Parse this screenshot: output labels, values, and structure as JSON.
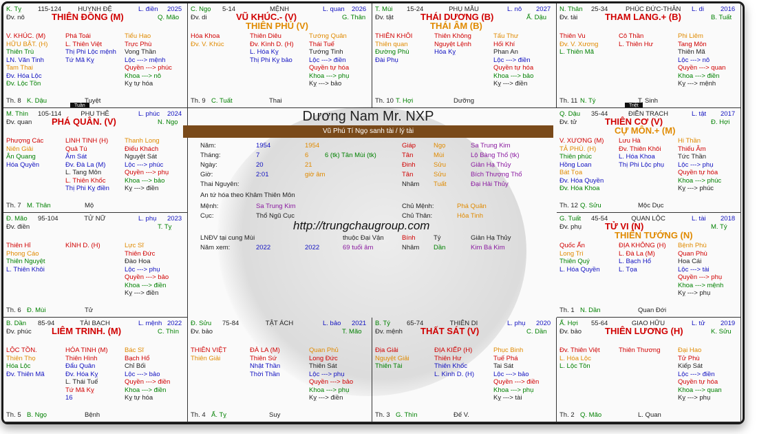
{
  "header": {
    "title": "Dương Nam  Mr. NXP",
    "band": "Vũ Phú Tí Ngọ sanh tài / lý tài",
    "url": "http://trungchaugroup.com"
  },
  "cells": {
    "ty": {
      "branch": "K. Tỵ",
      "range": "115-124",
      "palace": "HUYNH ĐỆ",
      "year_label": "L. điền",
      "year": "2025",
      "main": "THIÊN ĐỒNG  (M)",
      "dv": "Đv. nô",
      "dv2": "Q. Mão",
      "c1": [
        "V. KHÚC.  (M)",
        "HỮU BẬT.  (H)",
        "Thiên Trù",
        "LN. Văn Tinh",
        "Tam Thai",
        "Đv. Hóa Lộc",
        "Đv. Lộc Tồn"
      ],
      "c2": [
        "Phá Toái",
        "L. Thiên Việt",
        "Thị Phi Lộc mệnh",
        "Tứ Mã Kỵ"
      ],
      "c3": [
        "Tiểu Hao",
        "Trực Phù",
        "Vong Thần",
        "Lộc ---> mệnh",
        "Quyền ---> phúc",
        "Khoa ---> nô",
        "Kỵ tự hóa"
      ],
      "foot1": "Th. 8",
      "foot2": "K. Dậu",
      "foot3": "Tuyệt",
      "tag": "Tuần"
    },
    "ngo": {
      "branch": "C. Ngọ",
      "range": "5-14",
      "palace": "MỆNH",
      "year_label": "L. quan",
      "year": "2026",
      "main": "VŨ KHÚC.- (V)",
      "main2": "THIÊN PHỦ  (V)",
      "dv": "Đv. di",
      "dv2": "G. Thân",
      "c1": [
        "Hóa Khoa",
        "Đv. V. Khúc"
      ],
      "c2": [
        "Thiên Diêu",
        "Đv. Kình D.  (H)",
        "L. Hóa Kỵ",
        "Thị Phi Kỵ bảo"
      ],
      "c3": [
        "Tướng Quân",
        "Thái Tuế",
        "Tướng Tinh",
        "Lộc ---> điền",
        "Quyền tự hóa",
        "Khoa ---> phụ",
        "Kỵ ---> bảo"
      ],
      "foot1": "Th. 9",
      "foot2": "C. Tuất",
      "foot3": "Thai"
    },
    "mui": {
      "branch": "T. Mùi",
      "range": "15-24",
      "palace": "PHỤ MẪU",
      "year_label": "L. nô",
      "year": "2027",
      "main": "THÁI DƯƠNG  (B)",
      "main2": "THÁI ÂM  (B)",
      "dv": "Đv. tật",
      "dv2": "Ấ. Dậu",
      "c1": [
        "THIÊN KHÔI",
        "Thiên quan",
        "Đường Phù",
        "Đài Phụ"
      ],
      "c2": [
        "Thiên Không",
        "Nguyệt Lệnh",
        "Hóa Kỵ"
      ],
      "c3": [
        "Tấu Thư",
        "Hối Khí",
        "Phan An",
        "Lộc ---> điền",
        "Quyền tự hóa",
        "Khoa ---> bảo",
        "Kỵ ---> điền"
      ],
      "foot1": "Th. 10",
      "foot2": "T. Hợi",
      "foot3": "Dưỡng"
    },
    "than": {
      "branch": "N. Thân",
      "range": "25-34",
      "palace": "PHÚC ĐỨC-THÂN",
      "year_label": "L. di",
      "year": "2016",
      "main": "THAM LANG.+ (B)",
      "dv": "Đv. tài",
      "dv2": "B. Tuất",
      "c1": [
        "Thiên Vu",
        "Đv. V. Xương",
        "L. Thiên Mã"
      ],
      "c2": [
        "Cô Thần",
        "L. Thiên Hư"
      ],
      "c3": [
        "Phi Liêm",
        "Tang Môn",
        "Thiên Mã",
        "Lộc ---> nô",
        "Quyền ---> quan",
        "Khoa ---> điền",
        "Kỵ ---> mệnh"
      ],
      "foot1": "Th. 11",
      "foot2": "N. Tý",
      "foot3": "T. Sinh",
      "tag": "Triệt"
    },
    "thin": {
      "branch": "M. Thìn",
      "range": "105-114",
      "palace": "PHU THÊ",
      "year_label": "L. phúc",
      "year": "2024",
      "main": "PHÁ QUÂN.  (V)",
      "dv": "Đv. quan",
      "dv2": "N. Ngọ",
      "c1": [
        "Phượng Các",
        "Niên Giải",
        "Ân Quang",
        "Hóa Quyền"
      ],
      "c2": [
        "LINH TINH  (H)",
        "Quả Tú",
        "Âm Sát",
        "Đv. Đà La  (M)",
        "L. Tang Môn",
        "L. Thiên Khốc",
        "Thị Phi Kỵ điền"
      ],
      "c3": [
        "Thanh Long",
        "Điếu Khách",
        "Nguyệt Sát",
        "Lộc ---> phúc",
        "Quyền ---> phụ",
        "Khoa ---> bảo",
        "Kỵ ---> điền"
      ],
      "foot1": "Th. 7",
      "foot2": "M. Thân",
      "foot3": "Mộ"
    },
    "dau": {
      "branch": "Q. Dậu",
      "range": "35-44",
      "palace": "ĐIỀN TRẠCH",
      "year_label": "L. tật",
      "year": "2017",
      "main": "THIÊN CƠ  (V)",
      "main2": "CỰ MÔN.+ (M)",
      "dv": "Đv. tử",
      "dv2": "Đ. Hợi",
      "c1": [
        "V. XƯƠNG  (M)",
        "TẢ PHÙ.  (H)",
        "Thiên phúc",
        "Hồng Loan",
        "Bát Tọa",
        "Đv. Hóa Quyền",
        "Đv. Hóa Khoa"
      ],
      "c2": [
        "Lưu Hà",
        "Đv. Thiên Khôi",
        "L. Hóa Khoa",
        "Thị Phi Lộc phụ"
      ],
      "c3": [
        "Hi Thần",
        "Thiếu Âm",
        "Tức Thần",
        "Lộc ---> phụ",
        "Quyền tự hóa",
        "Khoa ---> phúc",
        "Kỵ ---> phúc"
      ],
      "foot1": "Th. 12",
      "foot2": "Q. Sửu",
      "foot3": "Mộc Dục"
    },
    "mao": {
      "branch": "Đ. Mão",
      "range": "95-104",
      "palace": "TỬ NỮ",
      "year_label": "L. phụ",
      "year": "2023",
      "main": "",
      "dv": "Đv. điền",
      "dv2": "T. Tỵ",
      "c1": [
        "Thiên Hỉ",
        "Phong Cáo",
        "Thiên Nguyệt",
        "L. Thiên Khôi"
      ],
      "c2": [
        "KÌNH D.  (H)"
      ],
      "c3": [
        "Lực Sĩ",
        "Thiên Đức",
        "Đào Hoa",
        "Lộc ---> phụ",
        "Quyền ---> bảo",
        "Khoa ---> điền",
        "Kỵ ---> điền"
      ],
      "foot1": "Th. 6",
      "foot2": "Đ. Mùi",
      "foot3": "Tử"
    },
    "tuat": {
      "branch": "G. Tuất",
      "range": "45-54",
      "palace": "QUAN LỘC",
      "year_label": "L. tài",
      "year": "2018",
      "main": "TỬ VI  (N)",
      "main2": "THIÊN TƯỚNG  (N)",
      "dv": "Đv. phụ",
      "dv2": "M. Tý",
      "c1": [
        "Quốc Ấn",
        "Long Trì",
        "Thiên Quý",
        "L. Hóa Quyền"
      ],
      "c2": [
        "ĐỊA KHÔNG  (H)",
        "L. Đà La  (M)",
        "L. Bạch Hổ",
        "L. Tọa"
      ],
      "c3": [
        "Bệnh Phù",
        "Quan Phù",
        "Hoa Cái",
        "Lộc ---> tài",
        "Quyền ---> phụ",
        "Khoa ---> mệnh",
        "Kỵ ---> phụ"
      ],
      "foot1": "Th. 1",
      "foot2": "N. Dần",
      "foot3": "Quan Đới"
    },
    "dan": {
      "branch": "B. Dần",
      "range": "85-94",
      "palace": "TÀI BẠCH",
      "year_label": "L. mệnh",
      "year": "2022",
      "main": "LIÊM TRINH.  (M)",
      "dv": "Đv. phúc",
      "dv2": "C. Thìn",
      "c1": [
        "LỘC TỒN.",
        "Thiên Thọ",
        "Hóa Lộc",
        "Đv. Thiên Mã"
      ],
      "c2": [
        "HÓA TINH  (M)",
        "Thiên Hình",
        "Đẩu Quân",
        "Đv. Hóa Kỵ",
        "L. Thái Tuế",
        "Tứ Mã Kỵ",
        "16"
      ],
      "c3": [
        "Bác Sĩ",
        "Bạch Hổ",
        "Chỉ Bối",
        "Lộc ---> bảo",
        "Quyền ---> điền",
        "Khoa ---> điền",
        "Kỵ tự hóa"
      ],
      "foot1": "Th. 5",
      "foot2": "B. Ngọ",
      "foot3": "Bệnh"
    },
    "suu": {
      "branch": "Đ. Sửu",
      "range": "75-84",
      "palace": "TẬT ÁCH",
      "year_label": "L. bảo",
      "year": "2021",
      "main": "",
      "dv": "Đv. bảo",
      "dv2": "T. Mão",
      "c1": [
        "THIÊN VIỆT",
        "Thiên Giải"
      ],
      "c2": [
        "ĐÀ LA  (M)",
        "Thiên Sứ",
        "Nhật Thần",
        "Thời Thần"
      ],
      "c3": [
        "Quan Phủ",
        "Long Đức",
        "Thiên Sát",
        "Lộc ---> phụ",
        "Quyền ---> bảo",
        "Khoa ---> phụ",
        "Kỵ ---> điền"
      ],
      "foot1": "Th. 4",
      "foot2": "Ấ. Tỵ",
      "foot3": "Suy"
    },
    "ti": {
      "branch": "B. Tý",
      "range": "65-74",
      "palace": "THIÊN DI",
      "year_label": "L. phụ",
      "year": "2020",
      "main": "THẤT SÁT  (V)",
      "dv": "Đv. mệnh",
      "dv2": "C. Dần",
      "c1": [
        "Địa Giải",
        "Nguyệt Giải",
        "Thiên Tài"
      ],
      "c2": [
        "ĐỊA KIẾP  (H)",
        "Thiên Hư",
        "Thiên Khốc",
        "L. Kình D.  (H)"
      ],
      "c3": [
        "Phục Binh",
        "Tuế Phá",
        "Tai Sát",
        "Lộc ---> bảo",
        "Quyền ---> điền",
        "Khoa ---> phụ",
        "Kỵ ---> tài"
      ],
      "foot1": "Th. 3",
      "foot2": "G. Thìn",
      "foot3": "Đế V."
    },
    "hoi": {
      "branch": "Ấ. Hợi",
      "range": "55-64",
      "palace": "GIAO HỮU",
      "year_label": "L. tử",
      "year": "2019",
      "main": "THIÊN LƯƠNG  (H)",
      "dv": "Đv. bảo",
      "dv2": "K. Sửu",
      "c1": [
        "Đv. Thiên Việt",
        "L. Hóa Lộc",
        "L. Lộc Tồn"
      ],
      "c2": [
        "Thiên Thương"
      ],
      "c3": [
        "Đại Hao",
        "Tử Phù",
        "Kiếp Sát",
        "Lộc ---> điền",
        "Quyền tự hóa",
        "Khoa ---> quan",
        "Kỵ ---> phụ"
      ],
      "foot1": "Th. 2",
      "foot2": "Q. Mão",
      "foot3": "L. Quan"
    }
  },
  "info": {
    "rows": [
      [
        "Năm:",
        "1954",
        "1954",
        "",
        "Giáp",
        "Ngọ",
        "Sa Trung Kim"
      ],
      [
        "Tháng:",
        "7",
        "6",
        "6 (tk)  Tân  Mùi (tk)",
        "Tân",
        "Mùi",
        "Lộ Bàng Thổ (tk)"
      ],
      [
        "Ngày:",
        "20",
        "21",
        "",
        "Đinh",
        "Sửu",
        "Giản Hạ Thủy"
      ],
      [
        "Giờ:",
        "2:01",
        "giờ âm",
        "",
        "Tân",
        "Sửu",
        "Bích Thượng Thổ"
      ]
    ],
    "thai": "Thai Nguyên:",
    "thai_can": "Nhâm",
    "thai_chi": "Tuất",
    "thai_nap": "Đại Hải Thủy",
    "an_tu_hoa": "An tứ hóa theo Khâm Thiên Môn",
    "menh_label": "Mệnh:",
    "menh": "Sa Trung Kim",
    "chu_menh_label": "Chủ Mệnh:",
    "chu_menh": "Phá Quân",
    "cuc_label": "Cục:",
    "cuc": "Thổ Ngũ Cục",
    "chu_than_label": "Chủ Thân:",
    "chu_than": "Hỏa Tinh",
    "lndv": "LNĐV tại cung Mùi",
    "dai_van": "thuộc Đại Vận",
    "dv_can": "Bính",
    "dv_chi": "Tý",
    "dv_nap": "Giản Hạ Thủy",
    "nam_xem_label": "Năm xem:",
    "nam_xem": "2022",
    "nam_xem2": "2022",
    "tuoi": "69 tuổi âm",
    "nx_can": "Nhâm",
    "nx_chi": "Dần",
    "nx_nap": "Kim Bá Kim"
  }
}
